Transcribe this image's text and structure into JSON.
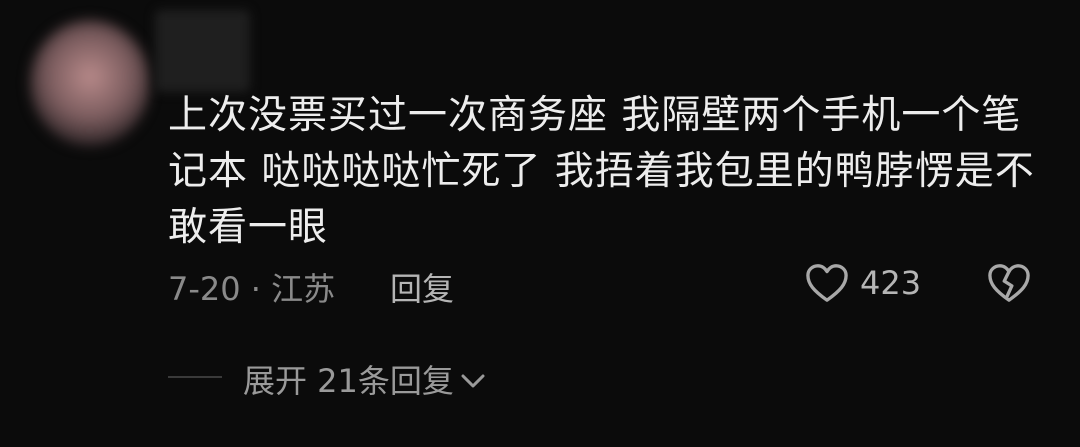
{
  "comment": {
    "text": "上次没票买过一次商务座 我隔壁两个手机一个笔记本 哒哒哒哒忙死了 我捂着我包里的鸭脖愣是不敢看一眼",
    "meta": "7-20 · 江苏",
    "reply_label": "回复",
    "like_count": "423"
  },
  "replies": {
    "expand_label": "展开 21条回复"
  },
  "icons": {
    "like": "heart-outline-icon",
    "dislike": "broken-heart-icon",
    "expand": "chevron-down-icon"
  },
  "colors": {
    "background": "#0b0b0b",
    "text_primary": "#ededed",
    "text_secondary": "#8a8a8a"
  }
}
